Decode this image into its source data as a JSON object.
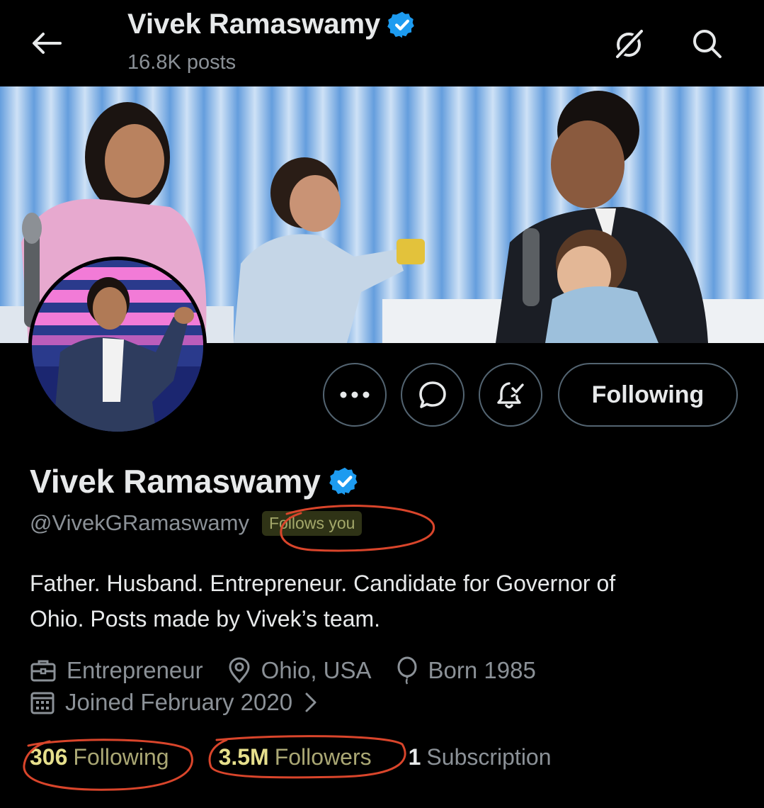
{
  "header": {
    "title": "Vivek Ramaswamy",
    "posts_count": "16.8K posts"
  },
  "actions": {
    "following_label": "Following"
  },
  "profile": {
    "name": "Vivek Ramaswamy",
    "handle": "@VivekGRamaswamy",
    "follows_you": "Follows you",
    "bio_line1": "Father. Husband. Entrepreneur. Candidate for Governor of",
    "bio_line2": "Ohio. Posts made by Vivek’s team.",
    "profession": "Entrepreneur",
    "location": "Ohio, USA",
    "born": "Born 1985",
    "joined": "Joined February 2020"
  },
  "stats": {
    "following_count": "306",
    "following_label": "Following",
    "followers_count": "3.5M",
    "followers_label": "Followers",
    "subscriptions_count": "1",
    "subscriptions_label": "Subscription"
  },
  "icons": {
    "back": "arrow-left-icon",
    "grok": "grok-icon",
    "search": "search-icon",
    "verified": "verified-badge-icon",
    "more": "more-dots-icon",
    "message": "message-bubble-icon",
    "notifications": "bell-check-icon",
    "profession": "briefcase-icon",
    "location": "location-pin-icon",
    "born": "balloon-icon",
    "joined": "calendar-icon"
  },
  "colors": {
    "background": "#000000",
    "verified_blue": "#1d9bf0",
    "secondary_text": "#8b9197",
    "annotation_red": "#d9452b",
    "highlight_yellow": "#e6df8c"
  }
}
